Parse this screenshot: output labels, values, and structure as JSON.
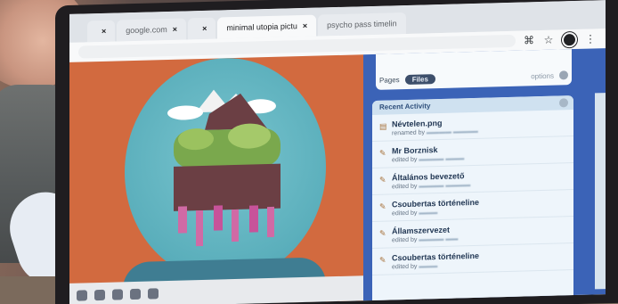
{
  "browser": {
    "tabs": [
      {
        "label": "",
        "active": false
      },
      {
        "label": "google.com",
        "active": false
      },
      {
        "label": "",
        "active": false
      },
      {
        "label": "minimal utopia pictu",
        "active": true
      },
      {
        "label": "psycho pass timelin",
        "active": false
      }
    ],
    "url": "",
    "icons": [
      "translate-icon",
      "star-icon",
      "profile-icon",
      "menu-icon"
    ]
  },
  "panel": {
    "pages_label": "Pages",
    "files_label": "Files",
    "options_label": "options",
    "recent_activity_title": "Recent Activity",
    "items": [
      {
        "title": "Névtelen.png",
        "action": "renamed by"
      },
      {
        "title": "Mr Borznisk",
        "action": "edited by"
      },
      {
        "title": "Általános bevezető",
        "action": "edited by"
      },
      {
        "title": "Csoubertas történeline",
        "action": "edited by"
      },
      {
        "title": "Államszervezet",
        "action": "edited by"
      },
      {
        "title": "Csoubertas történeline",
        "action": "edited by"
      }
    ]
  }
}
